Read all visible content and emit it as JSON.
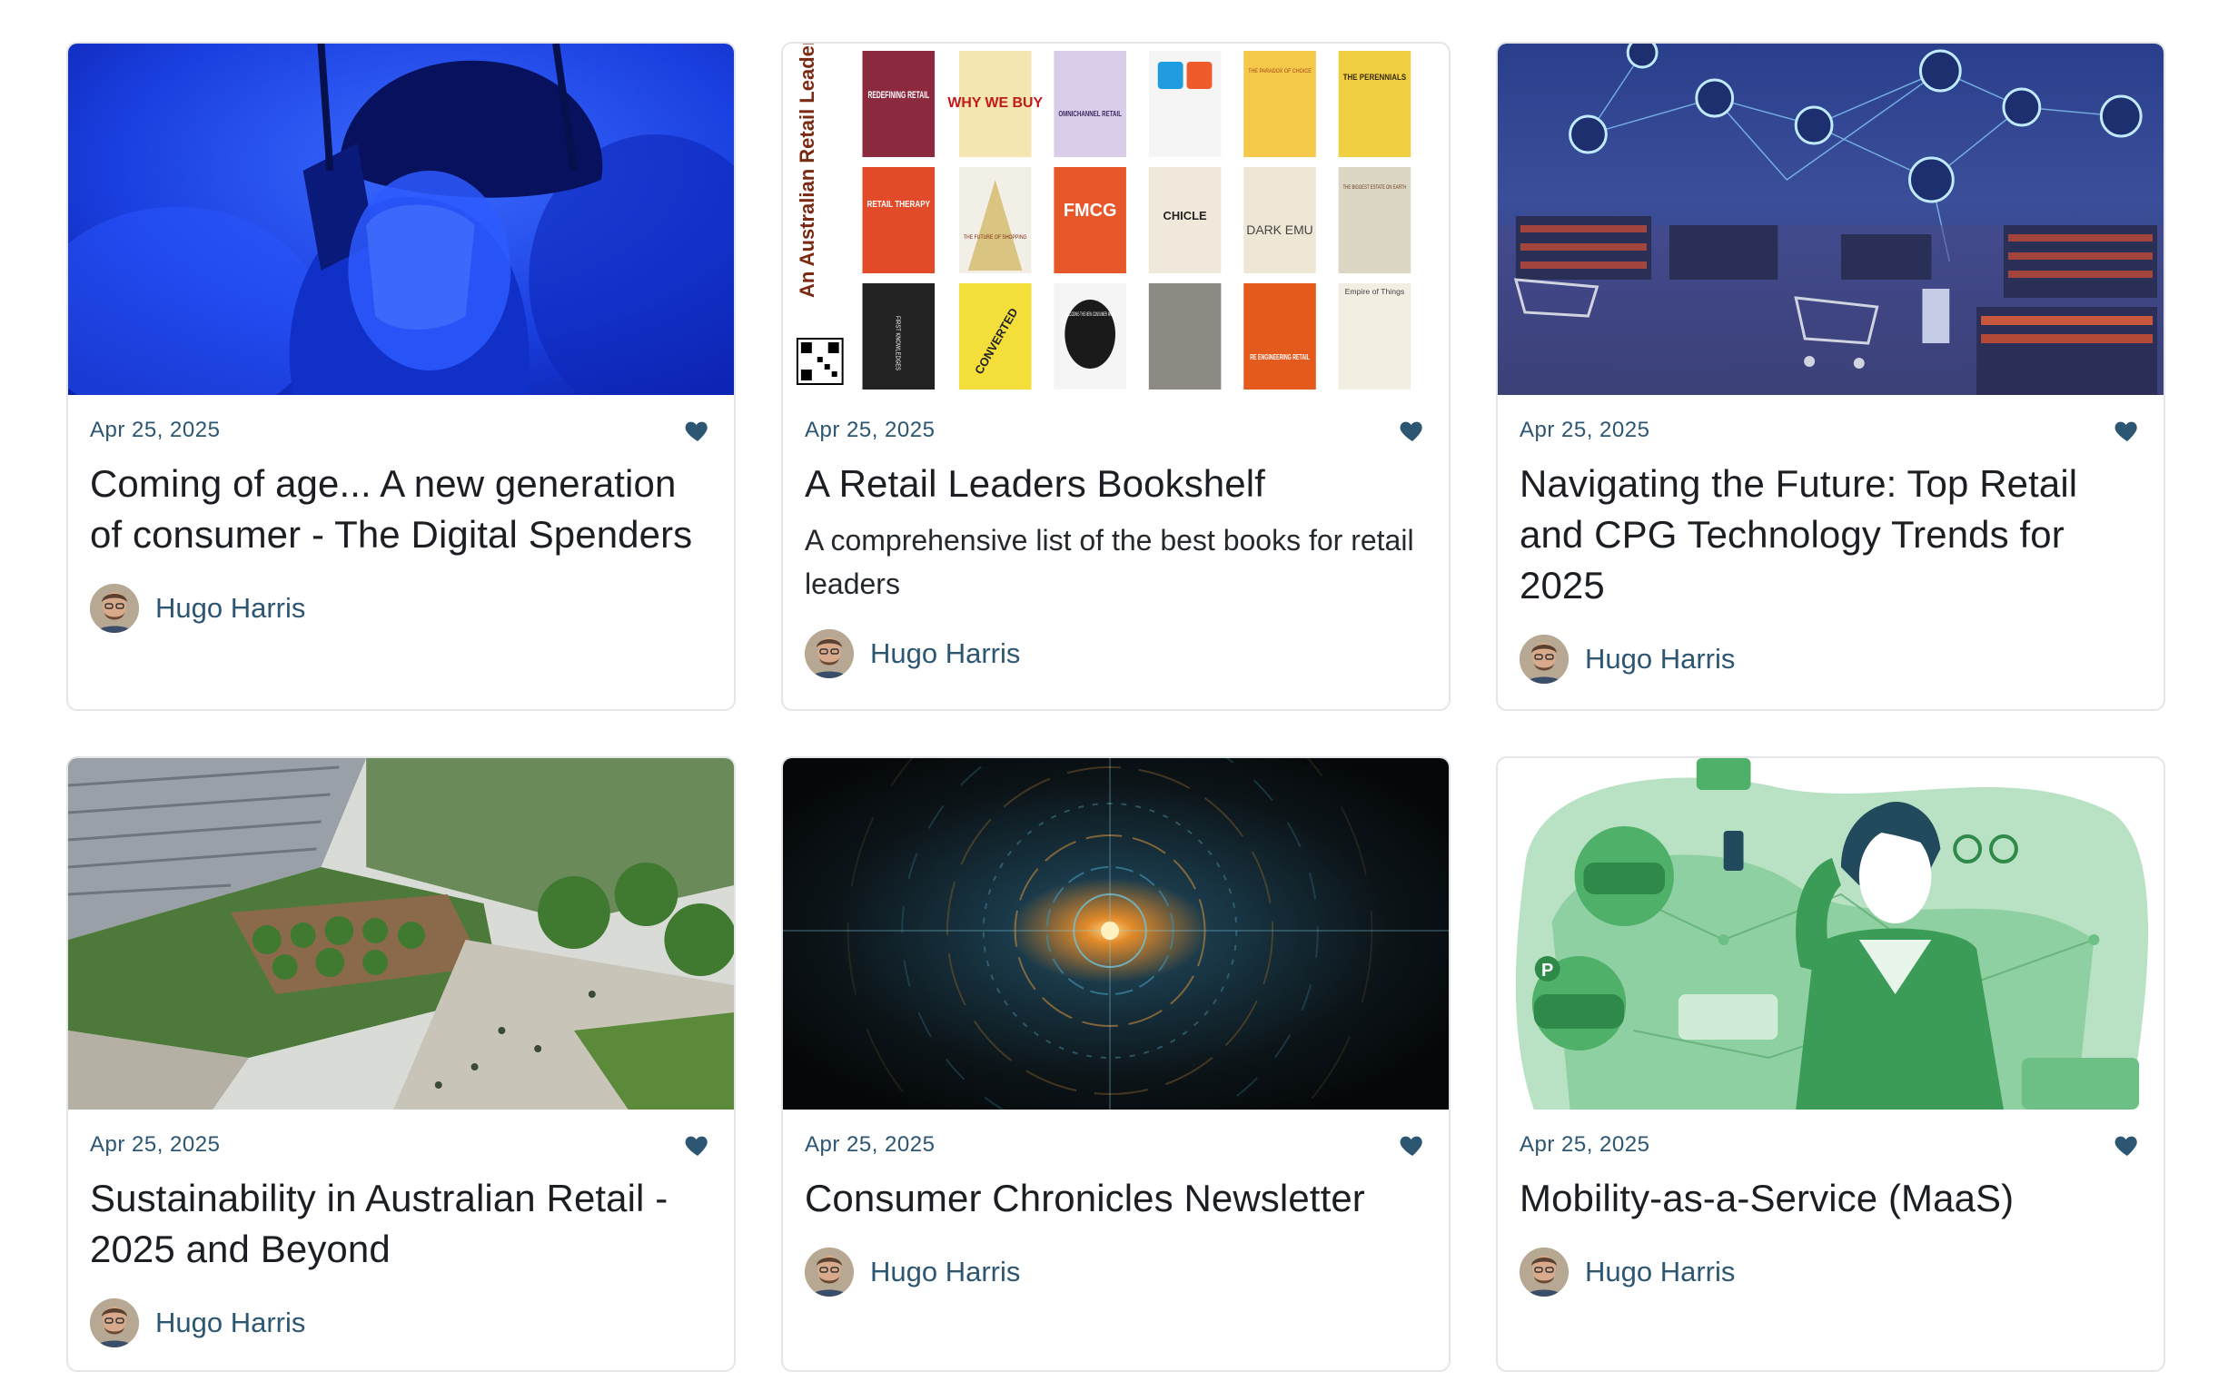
{
  "cards": [
    {
      "date": "Apr 25, 2025",
      "title": "Coming of age... A new generation of consumer - The Digital Spenders",
      "excerpt": "",
      "author": "Hugo Harris",
      "image": "blue-vr-headset-child-photo"
    },
    {
      "date": "Apr 25, 2025",
      "title": "A Retail Leaders Bookshelf",
      "excerpt": "A comprehensive list of the best books for retail leaders",
      "author": "Hugo Harris",
      "image": "book-covers-collage",
      "image_text": {
        "side_label": "An Australian Retail Leaders Booklist",
        "covers": [
          "REDEFINING RETAIL",
          "WHY WE BUY",
          "OMNICHANNEL RETAIL",
          "",
          "THE PARADOX OF CHOICE",
          "THE PERENNIALS",
          "RETAIL THERAPY",
          "THE FUTURE OF SHOPPING",
          "FMCG",
          "CHICLE",
          "DARK EMU",
          "THE BIGGEST ESTATE ON EARTH",
          "FIRST KNOWLEDGES",
          "CONVERTED",
          "DECODING THE NEW CONSUMER MIND",
          "",
          "RE ENGINEERING RETAIL",
          "Empire of Things"
        ]
      }
    },
    {
      "date": "Apr 25, 2025",
      "title": "Navigating the Future: Top Retail and CPG Technology Trends for 2025",
      "excerpt": "",
      "author": "Hugo Harris",
      "image": "futuristic-store-network-illustration"
    },
    {
      "date": "Apr 25, 2025",
      "title": "Sustainability in Australian Retail - 2025 and Beyond",
      "excerpt": "",
      "author": "Hugo Harris",
      "image": "green-rooftop-retail-precinct-render"
    },
    {
      "date": "Apr 25, 2025",
      "title": "Consumer Chronicles Newsletter",
      "excerpt": "",
      "author": "Hugo Harris",
      "image": "abstract-circular-data-vortex"
    },
    {
      "date": "Apr 25, 2025",
      "title": "Mobility-as-a-Service (MaaS)",
      "excerpt": "",
      "author": "Hugo Harris",
      "image": "green-mobility-illustration"
    }
  ],
  "colors": {
    "accent": "#2c5671",
    "border": "#e3e5e8",
    "heart": "#2c5671"
  },
  "icons": {
    "like": "heart-icon"
  }
}
